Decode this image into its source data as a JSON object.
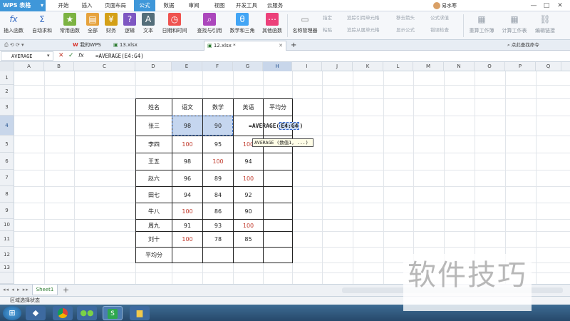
{
  "app": {
    "name": "WPS 表格",
    "user": "易水寒"
  },
  "menu": [
    "开始",
    "插入",
    "页面布局",
    "公式",
    "数据",
    "审阅",
    "视图",
    "开发工具",
    "云服务"
  ],
  "ribbon": {
    "insert_fn": "插入函数",
    "autosum": "自动求和",
    "common": "常用函数",
    "all": "全部",
    "finance": "财务",
    "logic": "逻辑",
    "text": "文本",
    "datetime": "日期和时间",
    "lookup": "查找与引用",
    "math": "数学和三角",
    "other": "其他函数",
    "name_mgr": "名称管理器",
    "paste": "粘贴",
    "specify": "指定",
    "trace_prec": "追踪引用单元格",
    "trace_dep": "追踪从属单元格",
    "remove_arrows": "移去箭头",
    "show_formula": "显示公式",
    "error_check": "错误检查",
    "formula_eval": "公式求值",
    "recalc": "重算工作簿",
    "calc_sheet": "计算工作表",
    "edit_link": "编辑链接"
  },
  "tabs": [
    {
      "label": "我的WPS"
    },
    {
      "label": "13.xlsx"
    },
    {
      "label": "12.xlsx *"
    }
  ],
  "tab_right": "点此查找命令",
  "formula_bar": {
    "name_box": "AVERAGE",
    "fx": "fx",
    "formula": "=AVERAGE(E4:G4)"
  },
  "columns": [
    "A",
    "B",
    "C",
    "D",
    "E",
    "F",
    "G",
    "H",
    "I",
    "J",
    "K",
    "L",
    "M",
    "N",
    "O",
    "P",
    "Q"
  ],
  "rows": [
    "1",
    "2",
    "3",
    "4",
    "5",
    "6",
    "7",
    "8",
    "9",
    "10",
    "11",
    "12",
    "13"
  ],
  "table": {
    "headers": [
      "姓名",
      "语文",
      "数学",
      "英语",
      "平均分"
    ],
    "rows": [
      [
        "张三",
        "98",
        "90",
        "",
        ""
      ],
      [
        "李四",
        "100",
        "95",
        "100",
        ""
      ],
      [
        "王五",
        "98",
        "100",
        "94",
        ""
      ],
      [
        "赵六",
        "96",
        "89",
        "100",
        ""
      ],
      [
        "田七",
        "94",
        "84",
        "92",
        ""
      ],
      [
        "牛八",
        "100",
        "86",
        "90",
        ""
      ],
      [
        "周九",
        "91",
        "93",
        "100",
        ""
      ],
      [
        "刘十",
        "100",
        "78",
        "85",
        ""
      ],
      [
        "平均分",
        "",
        "",
        "",
        ""
      ]
    ]
  },
  "edit_cell": {
    "prefix": "=AVERAGE(",
    "ref": "E4:G4",
    "suffix": ")"
  },
  "tooltip": "AVERAGE (数值1, ...)",
  "sheet_tab": "Sheet1",
  "status": "区域选择状态",
  "watermark": "软件技巧"
}
